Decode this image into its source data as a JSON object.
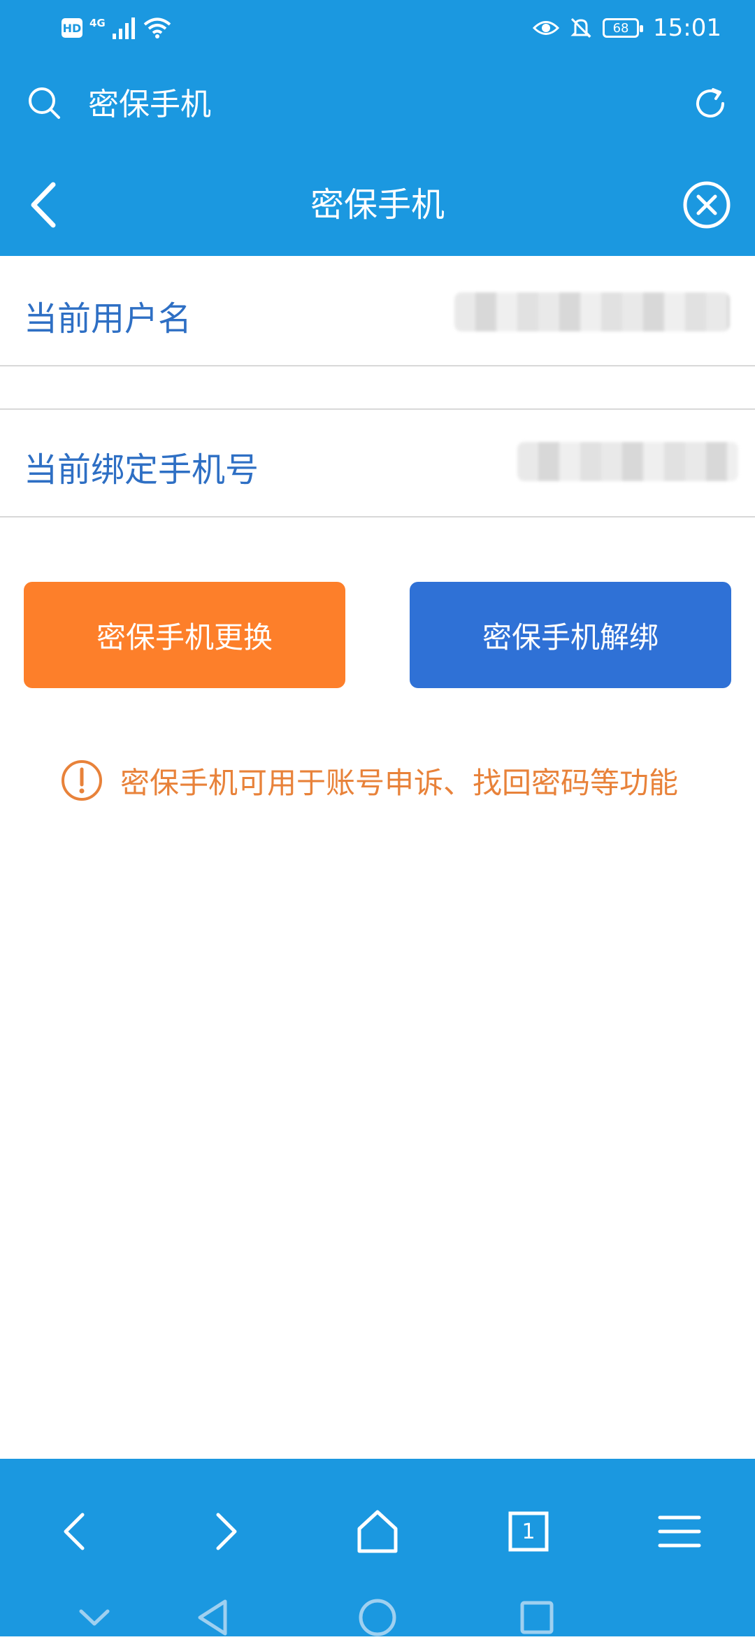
{
  "status_bar": {
    "hd": "HD",
    "network": "4G",
    "battery": "68",
    "time": "15:01"
  },
  "search": {
    "text": "密保手机"
  },
  "nav": {
    "title": "密保手机"
  },
  "rows": [
    {
      "label": "当前用户名"
    },
    {
      "label": "当前绑定手机号"
    }
  ],
  "buttons": {
    "change": "密保手机更换",
    "unbind": "密保手机解绑"
  },
  "notice": {
    "text": "密保手机可用于账号申诉、找回密码等功能"
  },
  "toolbar": {
    "tab_count": "1"
  },
  "colors": {
    "primary": "#1b98e0",
    "orange": "#fd7f2a",
    "blue_button": "#2f71d6",
    "label_blue": "#2e6fc4",
    "notice_orange": "#e8823a"
  }
}
